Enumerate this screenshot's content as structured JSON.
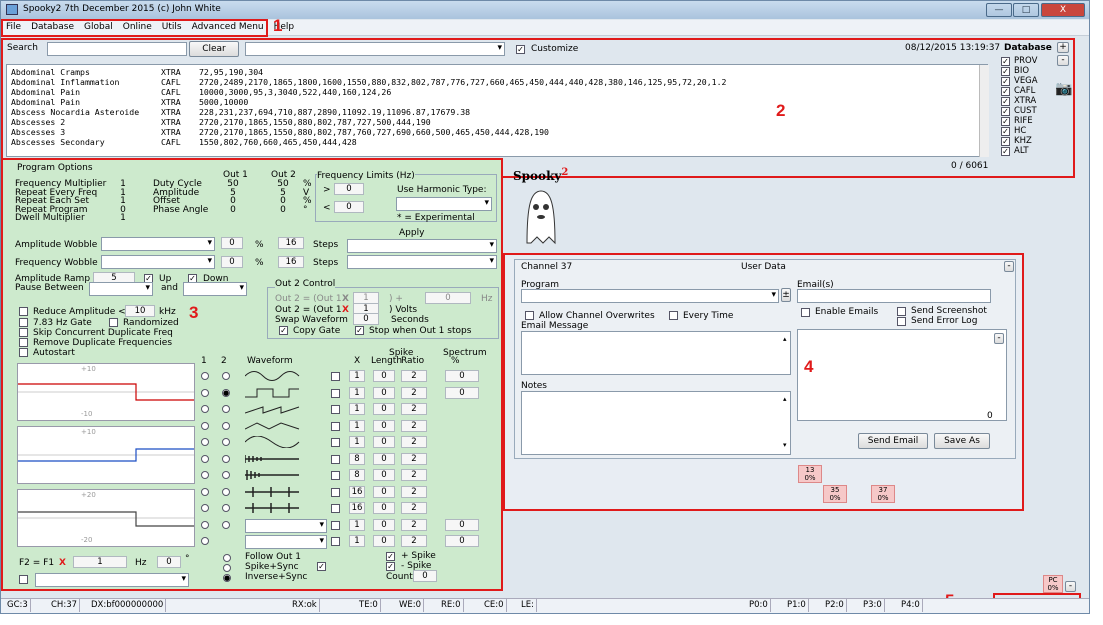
{
  "title": "Spooky2 7th December 2015 (c) John White",
  "window_buttons": [
    "—",
    "□",
    "X"
  ],
  "menu": [
    "File",
    "Database",
    "Global",
    "Online",
    "Utils",
    "Advanced Menu",
    "Help"
  ],
  "annotations": [
    "1",
    "2",
    "3",
    "4",
    "5"
  ],
  "search": {
    "label": "Search",
    "clear": "Clear",
    "customize": "Customize",
    "datetime": "08/12/2015  13:19:37",
    "count": "0 / 6061"
  },
  "database": {
    "title": "Database",
    "plus": "+",
    "minus": "-",
    "items": [
      "PROV",
      "BIO",
      "VEGA",
      "CAFL",
      "XTRA",
      "CUST",
      "RIFE",
      "HC",
      "KHZ",
      "ALT"
    ]
  },
  "programs": [
    {
      "name": "Abdominal Cramps",
      "db": "XTRA",
      "freqs": "72,95,190,304"
    },
    {
      "name": "Abdominal Inflammation",
      "db": "CAFL",
      "freqs": "2720,2489,2170,1865,1800,1600,1550,880,832,802,787,776,727,660,465,450,444,440,428,380,146,125,95,72,20,1.2"
    },
    {
      "name": "Abdominal Pain",
      "db": "CAFL",
      "freqs": "10000,3000,95,3,3040,522,440,160,124,26"
    },
    {
      "name": "Abdominal Pain",
      "db": "XTRA",
      "freqs": "5000,10000"
    },
    {
      "name": "Abscess Nocardia Asteroide",
      "db": "XTRA",
      "freqs": "228,231,237,694,710,887,2890,11092.19,11096.87,17679.38"
    },
    {
      "name": "Abscesses 2",
      "db": "XTRA",
      "freqs": "2720,2170,1865,1550,880,802,787,727,500,444,190"
    },
    {
      "name": "Abscesses 3",
      "db": "XTRA",
      "freqs": "2720,2170,1865,1550,880,802,787,760,727,690,660,500,465,450,444,428,190"
    },
    {
      "name": "Abscesses Secondary",
      "db": "CAFL",
      "freqs": "1550,802,760,660,465,450,444,428"
    }
  ],
  "program_options": {
    "title": "Program Options",
    "out1": "Out 1",
    "out2": "Out 2",
    "rows": [
      {
        "label": "Frequency Multiplier",
        "v": "1",
        "l2": "Duty Cycle",
        "o1": "50",
        "o2": "50",
        "u": "%"
      },
      {
        "label": "Repeat Every Freq",
        "v": "1",
        "l2": "Amplitude",
        "o1": "5",
        "o2": "5",
        "u": "V"
      },
      {
        "label": "Repeat Each Set",
        "v": "1",
        "l2": "Offset",
        "o1": "0",
        "o2": "0",
        "u": "%"
      },
      {
        "label": "Repeat Program",
        "v": "0",
        "l2": "Phase Angle",
        "o1": "0",
        "o2": "0",
        "u": "°"
      },
      {
        "label": "Dwell Multiplier",
        "v": "1"
      }
    ],
    "freq_limits": "Frequency Limits (Hz)",
    "gt": ">",
    "lt": "<",
    "fl1": "0",
    "fl2": "0",
    "harmonic": "Use Harmonic Type:",
    "experimental": "* = Experimental",
    "apply": "Apply",
    "amp_wobble": "Amplitude Wobble",
    "freq_wobble": "Frequency Wobble",
    "wob_pct": "0",
    "pct": "%",
    "wob_steps": "16",
    "steps": "Steps",
    "amp_ramp": "Amplitude Ramp",
    "ramp_val": "5",
    "up": "Up",
    "down": "Down",
    "pause_between": "Pause Between",
    "and": "and",
    "reduce_amp": "Reduce Amplitude <",
    "reduce_val": "10",
    "khz": "kHz",
    "gate": "7.83 Hz Gate",
    "randomized": "Randomized",
    "skip": "Skip Concurrent Duplicate Freq",
    "remove": "Remove Duplicate Frequencies",
    "autostart": "Autostart",
    "out2_title": "Out 2 Control",
    "out2_l1": "Out 2 = (Out 1",
    "x": "X",
    "one": "1",
    "plus": ") +",
    "zero": "0",
    "hz": "Hz",
    "out2_l2": "Out 2 = (Out 1",
    "volts": ") Volts",
    "swap": "Swap Waveform",
    "seconds": "Seconds",
    "copy_gate": "Copy Gate",
    "stop_when": "Stop when Out 1 stops",
    "col1": "1",
    "col2": "2",
    "waveform": "Waveform",
    "colx": "X",
    "spike": "Spike",
    "length": "Length",
    "ratio": "Ratio",
    "spectrum": "Spectrum",
    "spec_pct": "%",
    "wave_x": [
      "1",
      "1",
      "1",
      "1",
      "1",
      "8",
      "8",
      "16",
      "16",
      "1",
      "1"
    ],
    "wave_len": [
      "0",
      "0",
      "0",
      "0",
      "0",
      "0",
      "0",
      "0",
      "0",
      "0",
      "0"
    ],
    "wave_ratio": [
      "2",
      "2",
      "2",
      "2",
      "2",
      "2",
      "2",
      "2",
      "2",
      "2",
      "2"
    ],
    "wave_spec": [
      "0",
      "0",
      "",
      "",
      "",
      "",
      "",
      "",
      "",
      "0",
      "0"
    ],
    "graph_labels": [
      "+10",
      "-10",
      "+10",
      "+20",
      "-20"
    ],
    "f2": "F2 = F1",
    "f2x": "X",
    "f2v": "1",
    "f2hz": "Hz",
    "f2deg": "0",
    "f2deg_u": "°",
    "follow": "Follow Out 1",
    "spike_sync": "Spike+Sync",
    "inverse": "Inverse+Sync",
    "plus_spike": "+ Spike",
    "minus_spike": "- Spike",
    "count": "Count",
    "count_val": "0"
  },
  "logo": "Spooky",
  "logo_sup": "2",
  "channel": {
    "title": "Channel 37",
    "user_data": "User Data",
    "program": "Program",
    "allow": "Allow Channel Overwrites",
    "every": "Every Time",
    "email_msg": "Email Message",
    "notes": "Notes",
    "emails": "Email(s)",
    "enable": "Enable Emails",
    "screenshot": "Send Screenshot",
    "errorlog": "Send Error Log",
    "zero": "0",
    "send": "Send Email",
    "saveas": "Save As",
    "pm": "±",
    "dash": "-",
    "up": "▴",
    "down": "▾"
  },
  "channels": [
    {
      "top": "13",
      "bot": "0%"
    },
    {
      "top": "35",
      "bot": "0%"
    },
    {
      "top": "37",
      "bot": "0%"
    }
  ],
  "pc": {
    "top": "PC",
    "bot": "0%"
  },
  "status": [
    "GC:3",
    "CH:37",
    "DX:bf000000000",
    "RX:ok",
    "TE:0",
    "WE:0",
    "RE:0",
    "CE:0",
    "LE:",
    "P0:0",
    "P1:0",
    "P2:0",
    "P3:0",
    "P4:0"
  ]
}
